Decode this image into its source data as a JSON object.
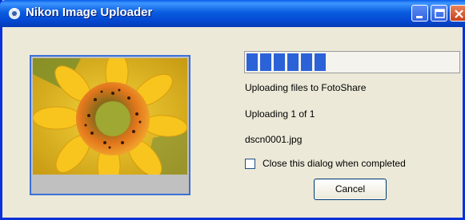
{
  "window": {
    "title": "Nikon Image Uploader"
  },
  "progress": {
    "fraction": 0.41,
    "segments": 6
  },
  "status": {
    "line1": "Uploading files to FotoShare",
    "line2": "Uploading 1 of 1",
    "file": "dscn0001.jpg"
  },
  "option": {
    "close_when_done_label": "Close this dialog when completed",
    "checked": false
  },
  "buttons": {
    "cancel_label": "Cancel"
  },
  "icons": {
    "app": "nikon-uploader-icon",
    "minimize": "minimize-icon",
    "maximize": "maximize-icon",
    "close": "close-icon",
    "photo": "sunflower-photo"
  },
  "colors": {
    "titlebar": "#0a5de0",
    "progress": "#2c62d8",
    "frame": "#3a70d8",
    "dialog_bg": "#ece9d8"
  }
}
